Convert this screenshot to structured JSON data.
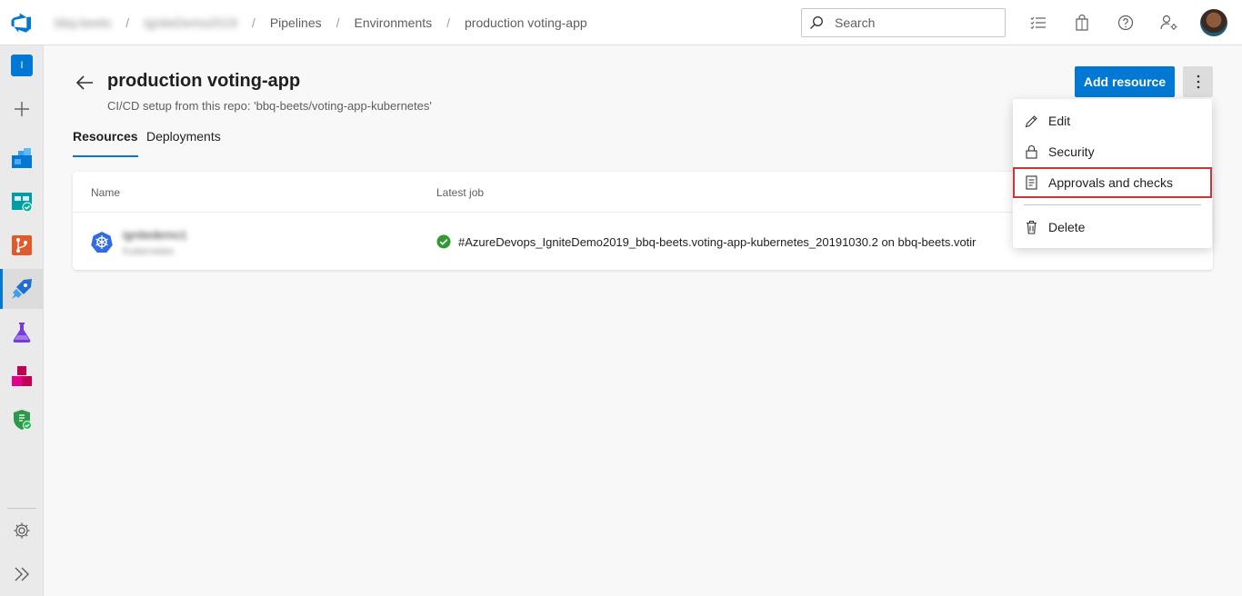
{
  "header": {
    "breadcrumbs": [
      {
        "label": "bbq-beets",
        "blurred": true
      },
      {
        "label": "IgniteDemo2019",
        "blurred": true
      },
      {
        "label": "Pipelines",
        "blurred": false
      },
      {
        "label": "Environments",
        "blurred": false
      },
      {
        "label": "production voting-app",
        "blurred": false
      }
    ],
    "search": {
      "placeholder": "Search",
      "value": ""
    },
    "icons": [
      "task-list-icon",
      "shopping-bag-icon",
      "help-icon",
      "user-settings-icon"
    ]
  },
  "leftnav": {
    "org_initial": "I",
    "items": [
      {
        "name": "organization",
        "icon": "org-badge-icon"
      },
      {
        "name": "create-new",
        "icon": "plus-icon"
      },
      {
        "name": "overview",
        "icon": "overview-icon"
      },
      {
        "name": "boards",
        "icon": "boards-icon"
      },
      {
        "name": "repos",
        "icon": "repos-icon"
      },
      {
        "name": "pipelines",
        "icon": "pipelines-icon",
        "active": true
      },
      {
        "name": "test-plans",
        "icon": "test-plans-icon"
      },
      {
        "name": "artifacts",
        "icon": "artifacts-icon"
      },
      {
        "name": "security",
        "icon": "security-shield-icon"
      }
    ],
    "bottom": [
      "settings-icon",
      "expand-icon"
    ]
  },
  "page": {
    "title": "production voting-app",
    "subtitle": "CI/CD setup from this repo: 'bbq-beets/voting-app-kubernetes'",
    "tabs": [
      {
        "label": "Resources",
        "selected": true
      },
      {
        "label": "Deployments",
        "selected": false
      }
    ],
    "add_resource_label": "Add resource"
  },
  "table": {
    "columns": [
      "Name",
      "Latest job"
    ],
    "rows": [
      {
        "name": "ignitedemo1",
        "subtitle": "Kubernetes",
        "status": "succeeded",
        "latest_job": "#AzureDevops_IgniteDemo2019_bbq-beets.voting-app-kubernetes_20191030.2 on bbq-beets.votir"
      }
    ]
  },
  "context_menu": {
    "items": [
      {
        "label": "Edit",
        "icon": "pencil-icon"
      },
      {
        "label": "Security",
        "icon": "lock-icon"
      },
      {
        "label": "Approvals and checks",
        "icon": "checklist-icon",
        "highlighted": true
      },
      {
        "label": "Delete",
        "icon": "trash-icon"
      }
    ]
  },
  "colors": {
    "accent": "#0078d4",
    "highlight_border": "#d13438",
    "success": "#107c10"
  }
}
